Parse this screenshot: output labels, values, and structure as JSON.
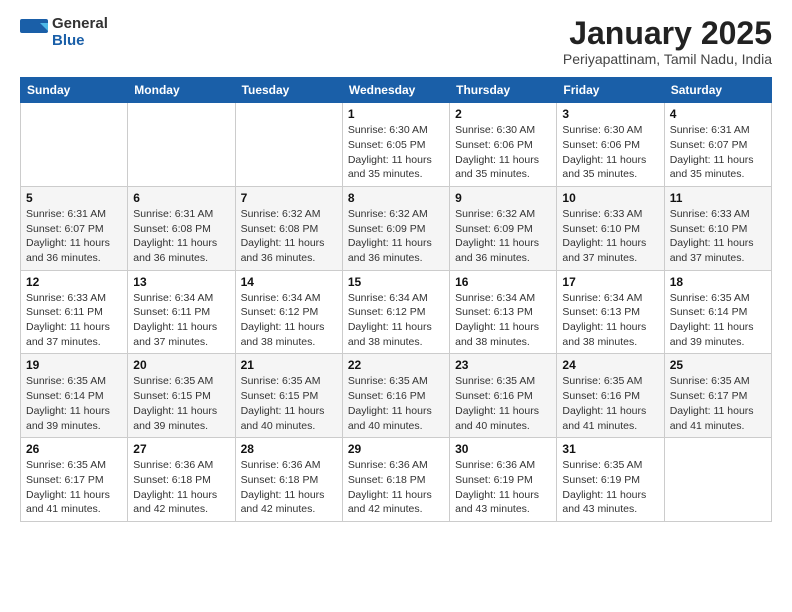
{
  "logo": {
    "general": "General",
    "blue": "Blue"
  },
  "header": {
    "month": "January 2025",
    "location": "Periyapattinam, Tamil Nadu, India"
  },
  "days_of_week": [
    "Sunday",
    "Monday",
    "Tuesday",
    "Wednesday",
    "Thursday",
    "Friday",
    "Saturday"
  ],
  "weeks": [
    [
      {
        "day": "",
        "info": ""
      },
      {
        "day": "",
        "info": ""
      },
      {
        "day": "",
        "info": ""
      },
      {
        "day": "1",
        "info": "Sunrise: 6:30 AM\nSunset: 6:05 PM\nDaylight: 11 hours\nand 35 minutes."
      },
      {
        "day": "2",
        "info": "Sunrise: 6:30 AM\nSunset: 6:06 PM\nDaylight: 11 hours\nand 35 minutes."
      },
      {
        "day": "3",
        "info": "Sunrise: 6:30 AM\nSunset: 6:06 PM\nDaylight: 11 hours\nand 35 minutes."
      },
      {
        "day": "4",
        "info": "Sunrise: 6:31 AM\nSunset: 6:07 PM\nDaylight: 11 hours\nand 35 minutes."
      }
    ],
    [
      {
        "day": "5",
        "info": "Sunrise: 6:31 AM\nSunset: 6:07 PM\nDaylight: 11 hours\nand 36 minutes."
      },
      {
        "day": "6",
        "info": "Sunrise: 6:31 AM\nSunset: 6:08 PM\nDaylight: 11 hours\nand 36 minutes."
      },
      {
        "day": "7",
        "info": "Sunrise: 6:32 AM\nSunset: 6:08 PM\nDaylight: 11 hours\nand 36 minutes."
      },
      {
        "day": "8",
        "info": "Sunrise: 6:32 AM\nSunset: 6:09 PM\nDaylight: 11 hours\nand 36 minutes."
      },
      {
        "day": "9",
        "info": "Sunrise: 6:32 AM\nSunset: 6:09 PM\nDaylight: 11 hours\nand 36 minutes."
      },
      {
        "day": "10",
        "info": "Sunrise: 6:33 AM\nSunset: 6:10 PM\nDaylight: 11 hours\nand 37 minutes."
      },
      {
        "day": "11",
        "info": "Sunrise: 6:33 AM\nSunset: 6:10 PM\nDaylight: 11 hours\nand 37 minutes."
      }
    ],
    [
      {
        "day": "12",
        "info": "Sunrise: 6:33 AM\nSunset: 6:11 PM\nDaylight: 11 hours\nand 37 minutes."
      },
      {
        "day": "13",
        "info": "Sunrise: 6:34 AM\nSunset: 6:11 PM\nDaylight: 11 hours\nand 37 minutes."
      },
      {
        "day": "14",
        "info": "Sunrise: 6:34 AM\nSunset: 6:12 PM\nDaylight: 11 hours\nand 38 minutes."
      },
      {
        "day": "15",
        "info": "Sunrise: 6:34 AM\nSunset: 6:12 PM\nDaylight: 11 hours\nand 38 minutes."
      },
      {
        "day": "16",
        "info": "Sunrise: 6:34 AM\nSunset: 6:13 PM\nDaylight: 11 hours\nand 38 minutes."
      },
      {
        "day": "17",
        "info": "Sunrise: 6:34 AM\nSunset: 6:13 PM\nDaylight: 11 hours\nand 38 minutes."
      },
      {
        "day": "18",
        "info": "Sunrise: 6:35 AM\nSunset: 6:14 PM\nDaylight: 11 hours\nand 39 minutes."
      }
    ],
    [
      {
        "day": "19",
        "info": "Sunrise: 6:35 AM\nSunset: 6:14 PM\nDaylight: 11 hours\nand 39 minutes."
      },
      {
        "day": "20",
        "info": "Sunrise: 6:35 AM\nSunset: 6:15 PM\nDaylight: 11 hours\nand 39 minutes."
      },
      {
        "day": "21",
        "info": "Sunrise: 6:35 AM\nSunset: 6:15 PM\nDaylight: 11 hours\nand 40 minutes."
      },
      {
        "day": "22",
        "info": "Sunrise: 6:35 AM\nSunset: 6:16 PM\nDaylight: 11 hours\nand 40 minutes."
      },
      {
        "day": "23",
        "info": "Sunrise: 6:35 AM\nSunset: 6:16 PM\nDaylight: 11 hours\nand 40 minutes."
      },
      {
        "day": "24",
        "info": "Sunrise: 6:35 AM\nSunset: 6:16 PM\nDaylight: 11 hours\nand 41 minutes."
      },
      {
        "day": "25",
        "info": "Sunrise: 6:35 AM\nSunset: 6:17 PM\nDaylight: 11 hours\nand 41 minutes."
      }
    ],
    [
      {
        "day": "26",
        "info": "Sunrise: 6:35 AM\nSunset: 6:17 PM\nDaylight: 11 hours\nand 41 minutes."
      },
      {
        "day": "27",
        "info": "Sunrise: 6:36 AM\nSunset: 6:18 PM\nDaylight: 11 hours\nand 42 minutes."
      },
      {
        "day": "28",
        "info": "Sunrise: 6:36 AM\nSunset: 6:18 PM\nDaylight: 11 hours\nand 42 minutes."
      },
      {
        "day": "29",
        "info": "Sunrise: 6:36 AM\nSunset: 6:18 PM\nDaylight: 11 hours\nand 42 minutes."
      },
      {
        "day": "30",
        "info": "Sunrise: 6:36 AM\nSunset: 6:19 PM\nDaylight: 11 hours\nand 43 minutes."
      },
      {
        "day": "31",
        "info": "Sunrise: 6:35 AM\nSunset: 6:19 PM\nDaylight: 11 hours\nand 43 minutes."
      },
      {
        "day": "",
        "info": ""
      }
    ]
  ]
}
